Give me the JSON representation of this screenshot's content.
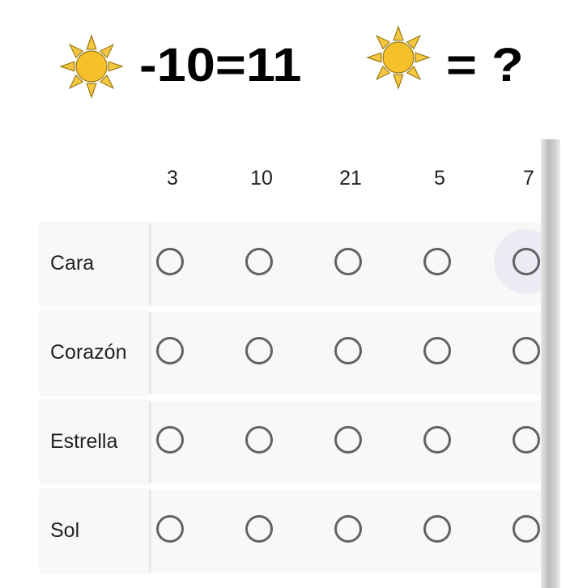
{
  "puzzle": {
    "left_equation": "-10=11",
    "right_equation": "= ?",
    "icon": "sun-icon",
    "sun_fill": "#f5c02a",
    "sun_ray_fill": "#f6c841",
    "sun_stroke": "#9a7a14"
  },
  "grid": {
    "columns": [
      "3",
      "10",
      "21",
      "5",
      "7"
    ],
    "rows": [
      {
        "label": "Cara"
      },
      {
        "label": "Corazón"
      },
      {
        "label": "Estrella"
      },
      {
        "label": "Sol"
      }
    ],
    "focused_option": {
      "row": "Cara",
      "column": "7"
    },
    "colors": {
      "row_background": "#f8f8f8",
      "radio_border": "#5f6368",
      "text": "#202124",
      "focus_halo": "#ecebf3"
    }
  }
}
